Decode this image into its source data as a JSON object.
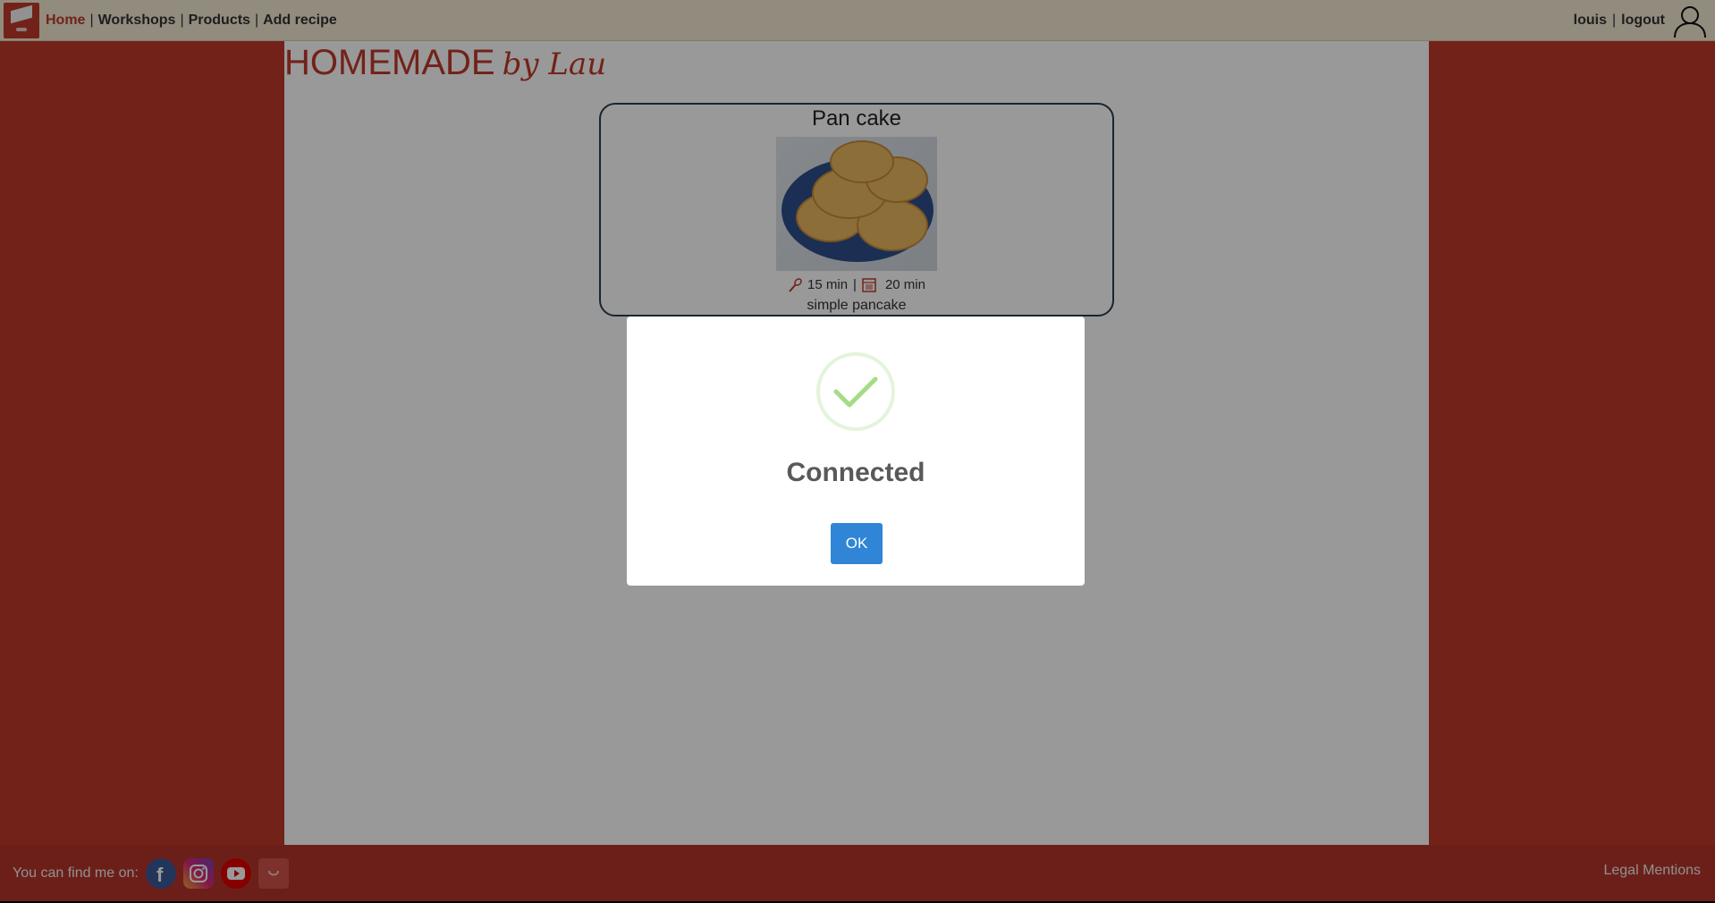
{
  "nav": {
    "items": [
      {
        "label": "Home"
      },
      {
        "label": "Workshops"
      },
      {
        "label": "Products"
      },
      {
        "label": "Add recipe"
      }
    ],
    "separator": "|",
    "user": "louis",
    "logout": "logout"
  },
  "brand": {
    "main": "HOMEMADE",
    "sub": "by Lau",
    "color": "#c0392b"
  },
  "recipe": {
    "title": "Pan cake",
    "prep_time": "15 min",
    "cook_time": "20 min",
    "separator": "|",
    "description": "simple pancake"
  },
  "footer": {
    "label": "You can find me on:",
    "socials": [
      {
        "icon": "facebook-icon"
      },
      {
        "icon": "instagram-icon"
      },
      {
        "icon": "youtube-icon"
      },
      {
        "icon": "blog-icon"
      }
    ],
    "legal": "Legal Mentions"
  },
  "modal": {
    "title": "Connected",
    "ok_label": "OK",
    "icon": "success-check-icon",
    "accent": "#3085d6",
    "success_color": "#a5dc86"
  }
}
